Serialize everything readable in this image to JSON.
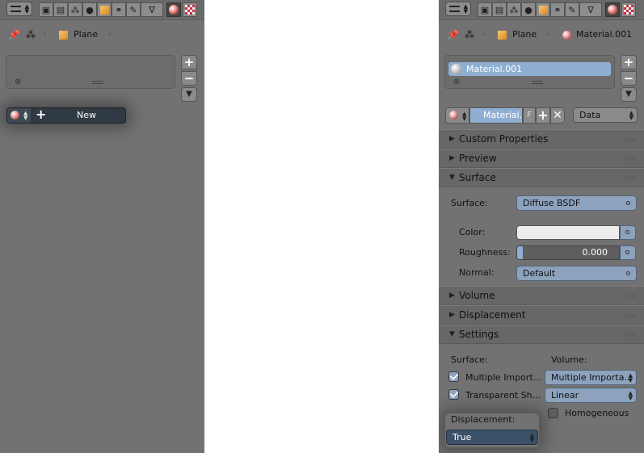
{
  "left_panel": {
    "path": {
      "object_name": "Plane"
    },
    "new_button": {
      "label": "New"
    }
  },
  "right_panel": {
    "path": {
      "object_name": "Plane",
      "material_name": "Material.001"
    },
    "slot_list": {
      "items": [
        {
          "label": "Material.001"
        }
      ]
    },
    "id_block": {
      "name": "Material.",
      "fake_user": "F",
      "link_select": "Data"
    },
    "sections": {
      "custom_properties": "Custom Properties",
      "preview": "Preview",
      "surface": "Surface",
      "volume": "Volume",
      "displacement": "Displacement",
      "settings": "Settings"
    },
    "surface": {
      "surface_label": "Surface:",
      "surface_value": "Diffuse BSDF",
      "color_label": "Color:",
      "color_value": "#ececec",
      "roughness_label": "Roughness:",
      "roughness_value": "0.000",
      "normal_label": "Normal:",
      "normal_value": "Default"
    },
    "settings": {
      "surface_header": "Surface:",
      "volume_header": "Volume:",
      "multiple_importance_label": "Multiple Import...",
      "multiple_importance_checked": true,
      "transparent_shadows_label": "Transparent Sh...",
      "transparent_shadows_checked": true,
      "volume_sampling_value": "Multiple Importa...",
      "volume_interpolation_value": "Linear",
      "homogeneous_label": "Homogeneous",
      "homogeneous_checked": false,
      "displacement_label": "Displacement:",
      "displacement_value": "True"
    }
  },
  "icons": {
    "tabs": [
      "render-icon",
      "render-layers-icon",
      "scene-icon",
      "world-icon",
      "object-icon",
      "constraints-icon",
      "modifiers-icon",
      "data-icon",
      "material-icon",
      "texture-icon"
    ]
  },
  "colors": {
    "panel_bg": "#727272",
    "header_bg": "#676767",
    "selected_blue": "#8fafd2",
    "node_socket_blue": "#8ca2bd",
    "dark_button": "#2f3a44"
  }
}
